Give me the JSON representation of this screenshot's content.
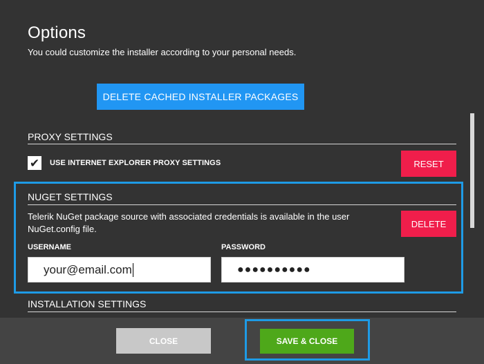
{
  "header": {
    "title": "Options",
    "subtitle": "You could customize the installer according to your personal needs."
  },
  "actions": {
    "delete_cache_label": "DELETE CACHED INSTALLER PACKAGES"
  },
  "proxy": {
    "header": "PROXY SETTINGS",
    "checkbox_label": "USE INTERNET EXPLORER PROXY SETTINGS",
    "checked": true,
    "reset_label": "RESET"
  },
  "nuget": {
    "header": "NUGET SETTINGS",
    "description": "Telerik NuGet package source with associated credentials is available in the user NuGet.config file.",
    "delete_label": "DELETE",
    "username_label": "USERNAME",
    "username_value": "your@email.com",
    "password_label": "PASSWORD",
    "password_value": "●●●●●●●●●●"
  },
  "installation": {
    "header": "INSTALLATION SETTINGS"
  },
  "footer": {
    "close_label": "CLOSE",
    "save_close_label": "SAVE & CLOSE"
  },
  "colors": {
    "background": "#333333",
    "accent_blue": "#2196f3",
    "danger_red": "#f01e4b",
    "success_green": "#4ea81a",
    "highlight": "#1e9be6"
  },
  "icons": {
    "checkbox": "checkmark-icon"
  }
}
